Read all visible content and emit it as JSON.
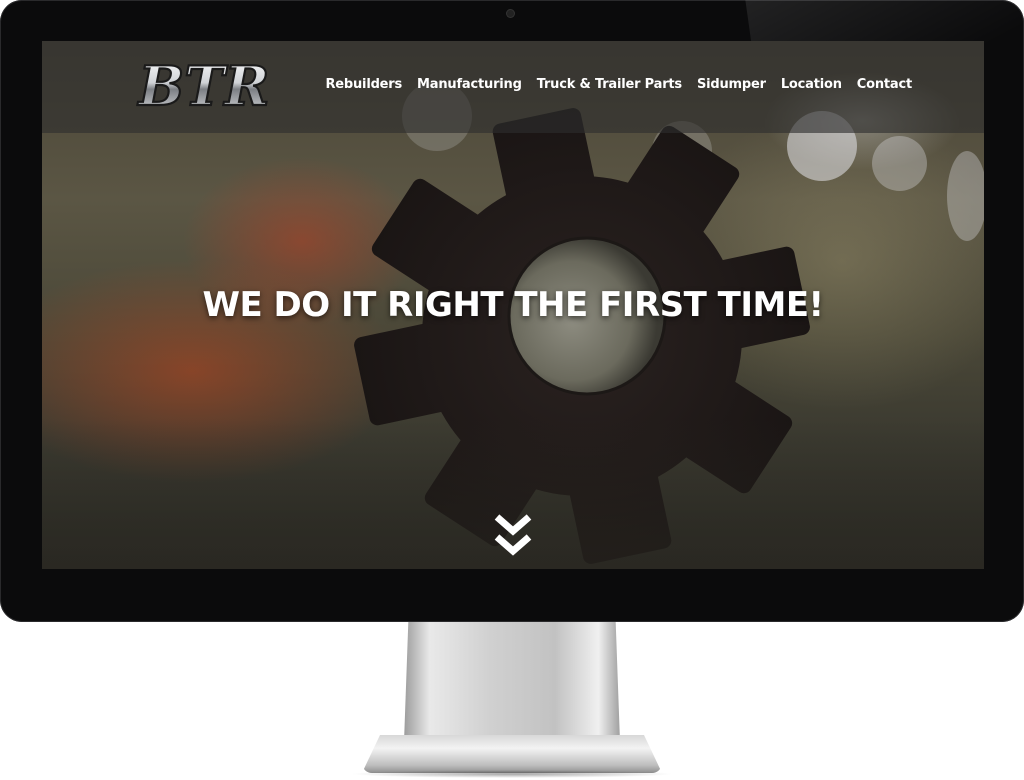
{
  "site": {
    "logo_text": "BTR",
    "nav": [
      {
        "label": "Rebuilders"
      },
      {
        "label": "Manufacturing"
      },
      {
        "label": "Truck & Trailer Parts"
      },
      {
        "label": "Sidumper"
      },
      {
        "label": "Location"
      },
      {
        "label": "Contact"
      }
    ],
    "hero": {
      "headline": "WE DO IT RIGHT THE FIRST TIME!",
      "scroll_icon": "double-chevron-down-icon"
    }
  },
  "colors": {
    "header_overlay": "#2d2d2d",
    "nav_text": "#ffffff",
    "headline": "#ffffff",
    "bezel": "#0b0b0c"
  }
}
